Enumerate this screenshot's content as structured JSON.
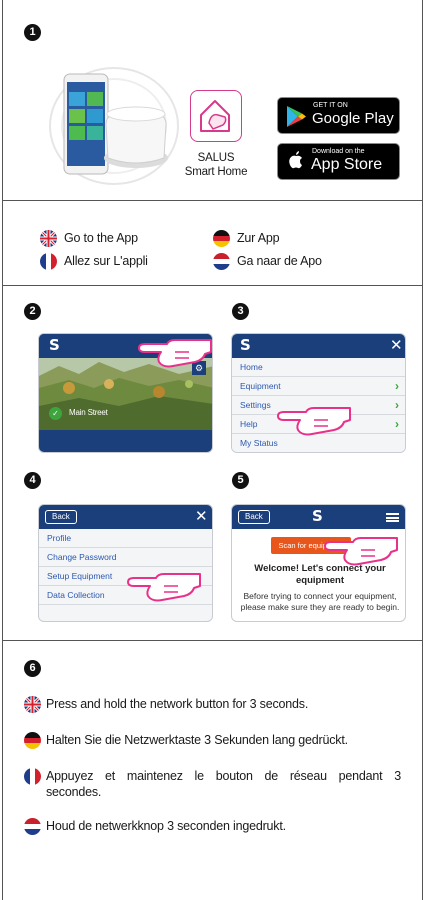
{
  "steps": [
    "1",
    "2",
    "3",
    "4",
    "5",
    "6"
  ],
  "app": {
    "name_line1": "SALUS",
    "name_line2": "Smart Home"
  },
  "google_play": {
    "small": "GET IT ON",
    "big": "Google Play"
  },
  "app_store": {
    "small": "Download on the",
    "big": "App Store"
  },
  "go_to_app": {
    "en": "Go to the App",
    "de": "Zur App",
    "fr": "Allez sur L'appli",
    "nl": "Ga naar de Apo"
  },
  "screen2": {
    "location": "Main Street"
  },
  "screen3": {
    "items": [
      "Home",
      "Equipment",
      "Settings",
      "Help",
      "My Status"
    ]
  },
  "screen4": {
    "back": "Back",
    "items": [
      "Profile",
      "Change Password",
      "Setup Equipment",
      "Data Collection"
    ]
  },
  "screen5": {
    "back": "Back",
    "scan": "Scan for equipment",
    "welcome": "Welcome! Let's connect your equipment",
    "body": "Before trying to connect your equipment, please make sure they are ready to begin."
  },
  "instructions": {
    "en": "Press and hold the network button for 3 seconds.",
    "de": "Halten Sie die Netzwerktaste 3 Sekunden lang gedrückt.",
    "fr_line1": "Appuyez et maintenez le bouton de réseau pendant 3",
    "fr_line2": "secondes.",
    "nl": "Houd de netwerkknop 3 seconden ingedrukt."
  },
  "colors": {
    "salus_blue": "#1b3f7a",
    "scan_orange": "#e8561c",
    "hand_pink": "#e8318a",
    "green": "#3ea53e"
  },
  "icons": [
    "uk-flag-icon",
    "german-flag-icon",
    "french-flag-icon",
    "dutch-flag-icon",
    "pointing-hand-icon",
    "salus-logo-icon",
    "close-icon",
    "menu-icon",
    "gear-icon",
    "check-icon",
    "play-store-icon",
    "apple-icon"
  ]
}
